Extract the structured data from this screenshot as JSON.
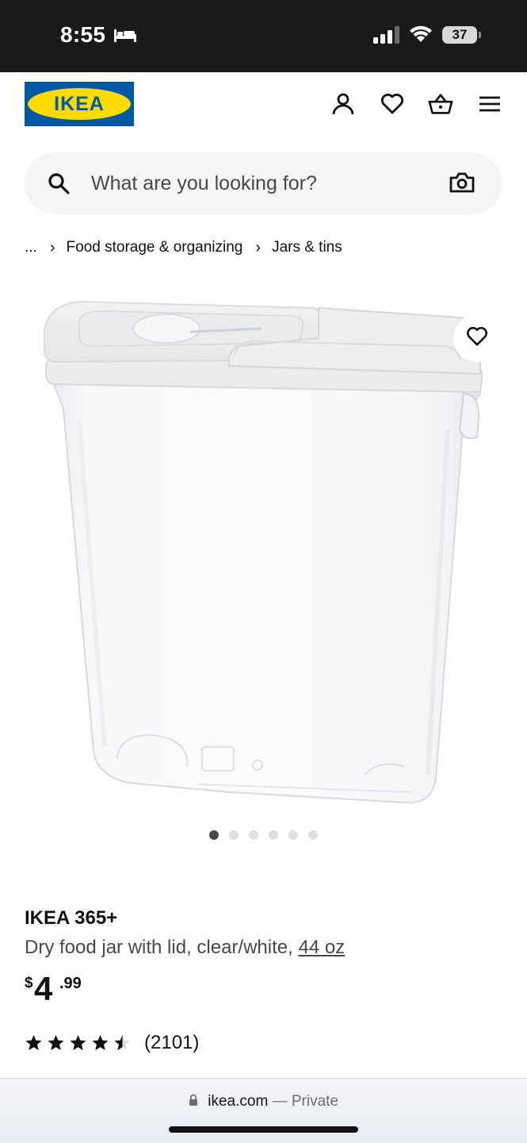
{
  "status_bar": {
    "time": "8:55",
    "battery": "37",
    "icons": [
      "bed-icon",
      "cellular-signal-icon",
      "wifi-icon",
      "battery-icon"
    ]
  },
  "header": {
    "logo_text": "IKEA",
    "icons": [
      "person-icon",
      "heart-icon",
      "basket-icon",
      "menu-icon"
    ]
  },
  "search": {
    "placeholder": "What are you looking for?",
    "icons": [
      "search-icon",
      "camera-icon"
    ]
  },
  "breadcrumb": {
    "ellipsis": "...",
    "items": [
      "Food storage & organizing",
      "Jars & tins"
    ]
  },
  "gallery": {
    "image_count": 6,
    "active_index": 0
  },
  "product": {
    "name": "IKEA 365+",
    "description": "Dry food jar with lid, clear/white, ",
    "size": "44 oz",
    "price": {
      "currency": "$",
      "integer": "4",
      "decimal": ".99"
    },
    "rating": {
      "stars": 4.5,
      "max_stars": 5,
      "count": "(2101)"
    }
  },
  "browser": {
    "url": "ikea.com",
    "separator": "—",
    "mode": "Private"
  },
  "colors": {
    "ikea_blue": "#0058a3",
    "ikea_yellow": "#ffdb00",
    "status_bar_bg": "#1a1a1a",
    "text_primary": "#111111",
    "text_secondary": "#484848"
  }
}
